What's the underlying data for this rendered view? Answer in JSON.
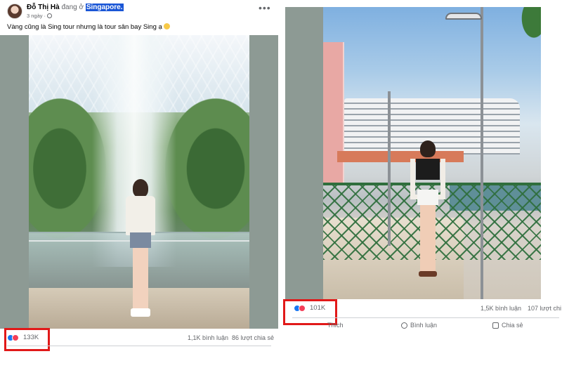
{
  "left_post": {
    "author": "Đỗ Thị Hà",
    "action": " đang ở ",
    "location": "Singapore.",
    "time": "3 ngày",
    "caption": "Vàng cũng là Sing tour nhưng là tour sân bay Sing ạ",
    "reactions": "133K",
    "comments": "1,1K bình luận",
    "shares": "86 lượt chia sẻ"
  },
  "right_post": {
    "reactions": "101K",
    "comments": "1,5K bình luận",
    "shares": "107 lượt chi",
    "actions": {
      "like": "Thích",
      "comment": "Bình luận",
      "share": "Chia sẻ"
    }
  },
  "colors": {
    "highlight": "#e11919",
    "like": "#1877f2",
    "love": "#f33e58",
    "location_bg": "#1a56d6"
  },
  "icons": [
    "like-icon",
    "love-icon",
    "globe-icon",
    "more-icon",
    "comment-icon",
    "share-icon",
    "emoji-icon"
  ]
}
